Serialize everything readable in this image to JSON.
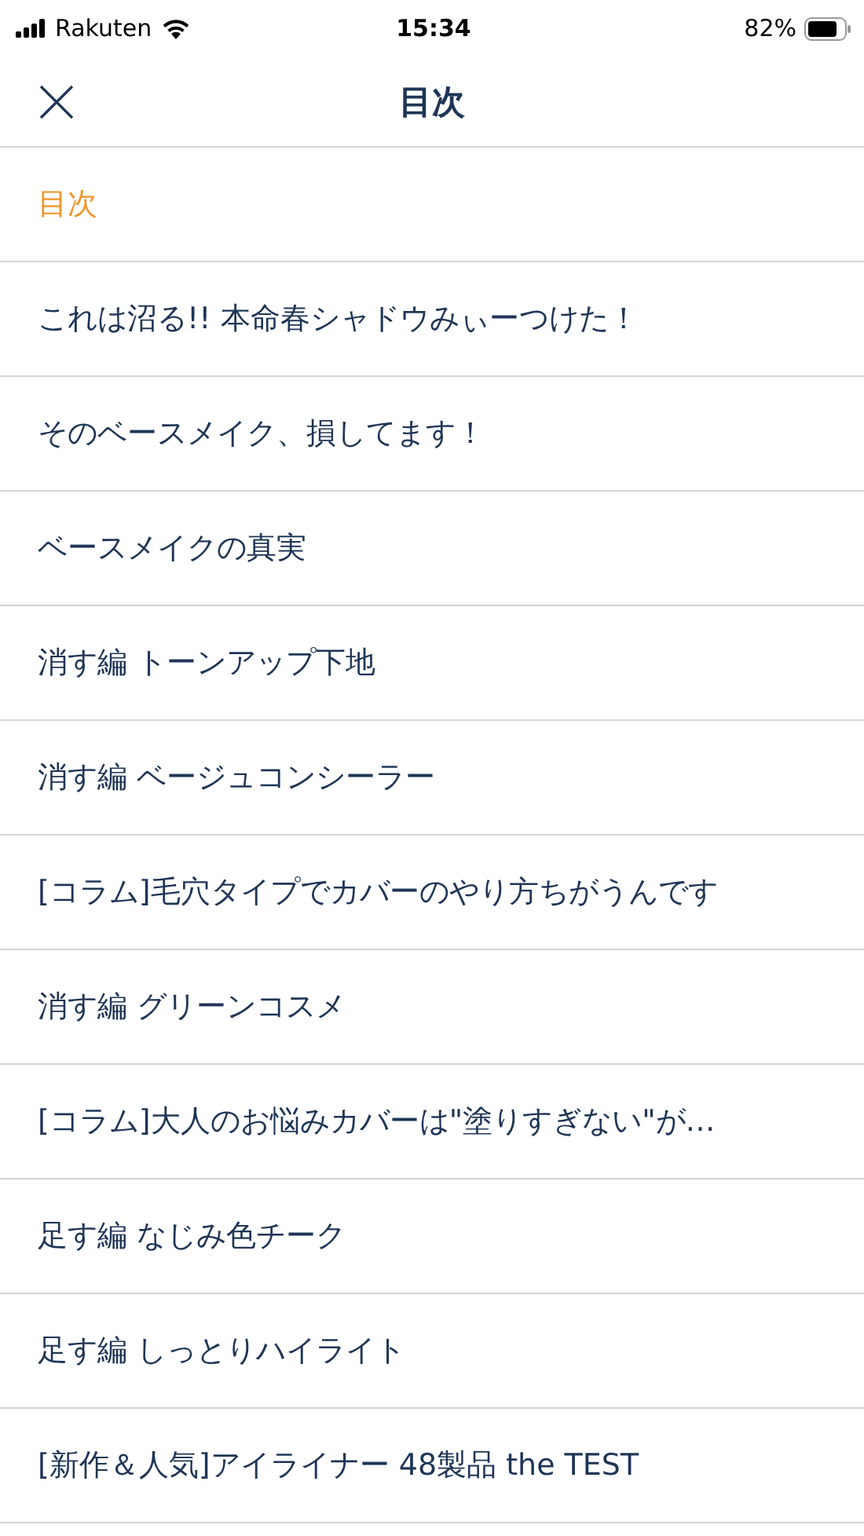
{
  "status_bar": {
    "carrier": "Rakuten",
    "time": "15:34",
    "battery": "82%"
  },
  "header": {
    "title": "目次"
  },
  "items": [
    {
      "label": "目次",
      "selected": true
    },
    {
      "label": "これは沼る!! 本命春シャドウみぃーつけた！",
      "selected": false
    },
    {
      "label": "そのベースメイク、損してます！",
      "selected": false
    },
    {
      "label": "ベースメイクの真実",
      "selected": false
    },
    {
      "label": "消す編 トーンアップ下地",
      "selected": false
    },
    {
      "label": "消す編 ベージュコンシーラー",
      "selected": false
    },
    {
      "label": "[コラム]毛穴タイプでカバーのやり方ちがうんです",
      "selected": false
    },
    {
      "label": "消す編 グリーンコスメ",
      "selected": false
    },
    {
      "label": "[コラム]大人のお悩みカバーは\"塗りすぎない\"が…",
      "selected": false
    },
    {
      "label": "足す編 なじみ色チーク",
      "selected": false
    },
    {
      "label": "足す編 しっとりハイライト",
      "selected": false
    },
    {
      "label": "[新作＆人気]アイライナー 48製品 the TEST",
      "selected": false
    }
  ]
}
